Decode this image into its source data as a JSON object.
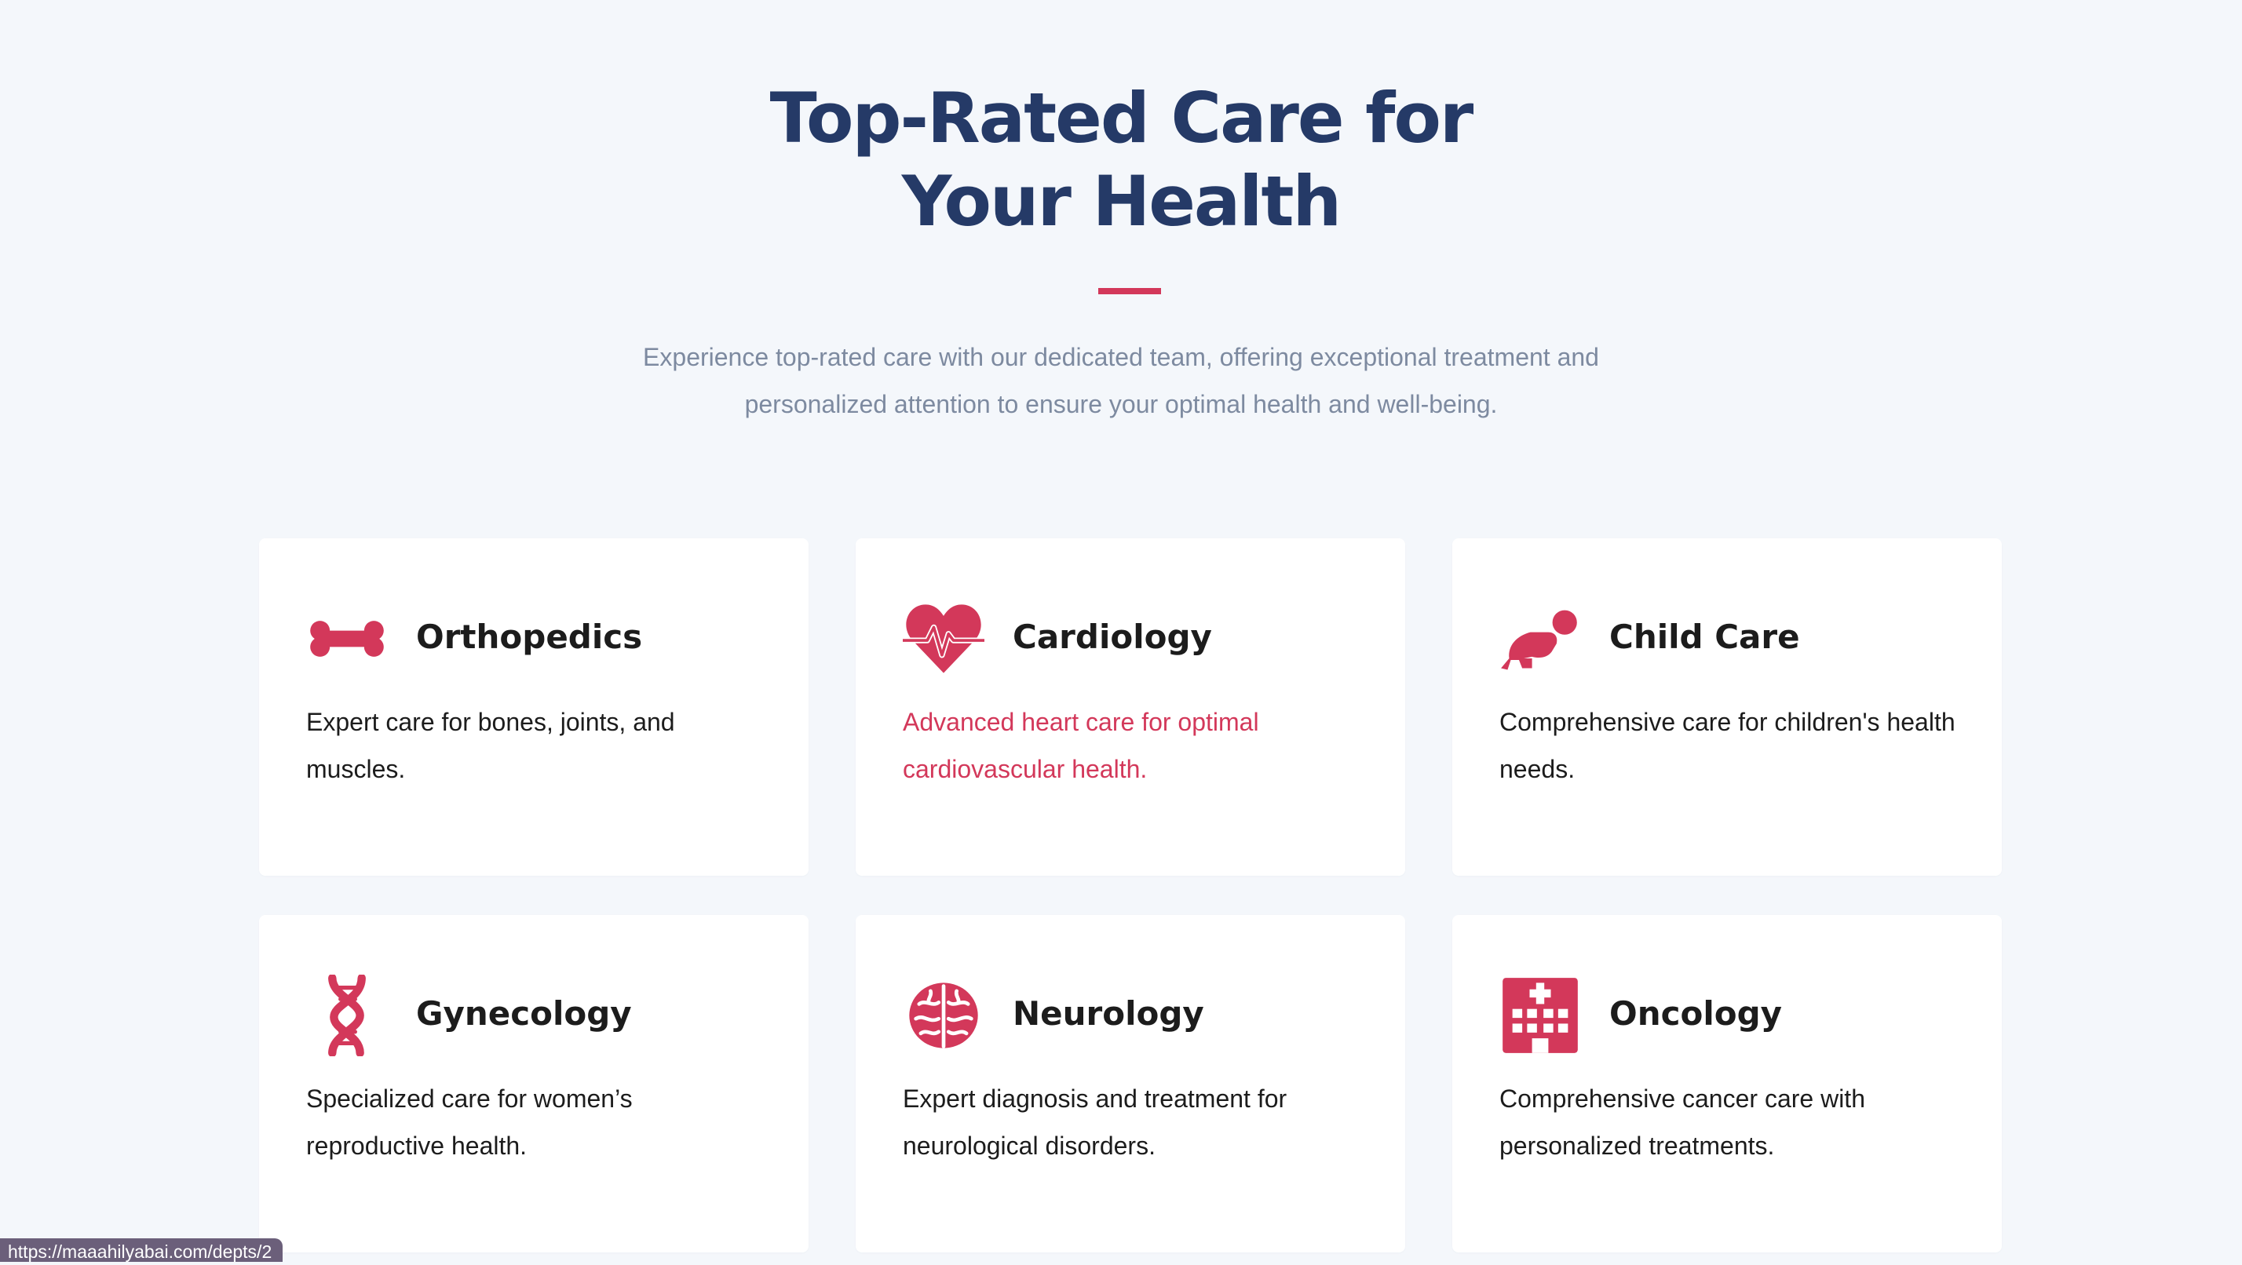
{
  "header": {
    "title": "Top-Rated Care for Your Health",
    "subtitle": "Experience top-rated care with our dedicated team, offering exceptional treatment and personalized attention to ensure your optimal health and well-being."
  },
  "colors": {
    "accent": "#d3385a",
    "title": "#253a67",
    "subtitle": "#7d8aa0",
    "background": "#f4f7fb",
    "card": "#ffffff"
  },
  "departments": [
    {
      "title": "Orthopedics",
      "description": "Expert care for bones, joints, and muscles.",
      "icon": "bone-icon"
    },
    {
      "title": "Cardiology",
      "description": "Advanced heart care for optimal cardiovascular health.",
      "icon": "heartbeat-icon"
    },
    {
      "title": "Child Care",
      "description": "Comprehensive care for children's health needs.",
      "icon": "baby-crawling-icon"
    },
    {
      "title": "Gynecology",
      "description": "Specialized care for women’s reproductive health.",
      "icon": "dna-icon"
    },
    {
      "title": "Neurology",
      "description": "Expert diagnosis and treatment for neurological disorders.",
      "icon": "brain-icon"
    },
    {
      "title": "Oncology",
      "description": "Comprehensive cancer care with personalized treatments.",
      "icon": "hospital-icon"
    }
  ],
  "status_bar": {
    "url": "https://maaahilyabai.com/depts/2"
  }
}
